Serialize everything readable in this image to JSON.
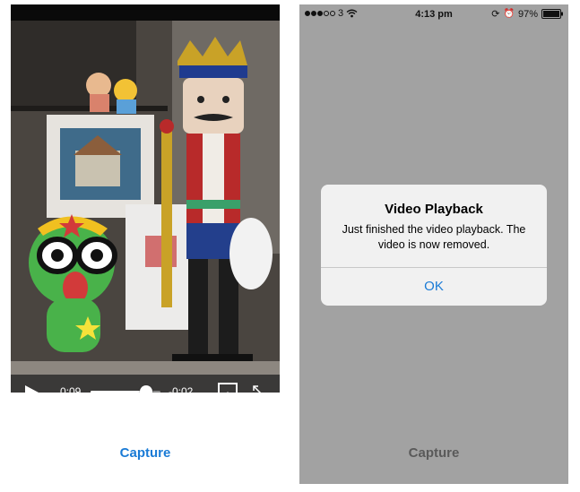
{
  "left_screen": {
    "player": {
      "time_elapsed": "0:09",
      "time_remaining": "-0:02",
      "progress_fraction": 0.8,
      "icons": {
        "play": "play-icon",
        "airplay": "airplay-icon",
        "fullscreen": "expand-icon"
      }
    },
    "capture_label": "Capture",
    "accent_color": "#1a7bd6"
  },
  "right_screen": {
    "status_bar": {
      "carrier": "3",
      "time": "4:13 pm",
      "battery": "97%"
    },
    "alert": {
      "title": "Video Playback",
      "message": "Just finished the video playback. The video is now removed.",
      "ok_label": "OK"
    },
    "capture_label": "Capture"
  }
}
